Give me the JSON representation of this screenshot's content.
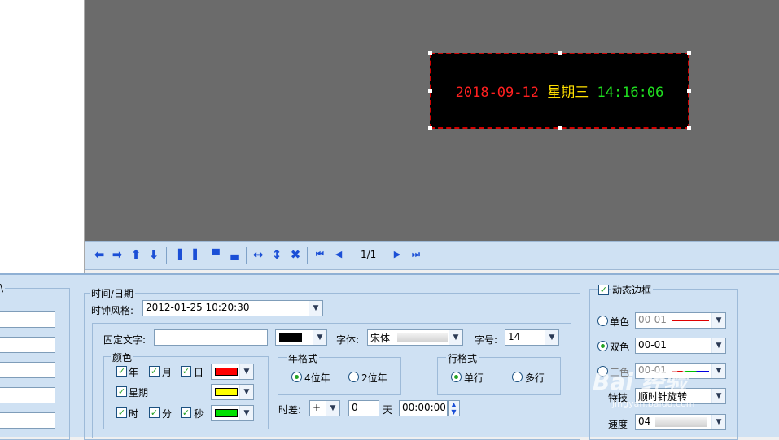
{
  "led": {
    "date": "2018-09-12",
    "weekday": "星期三",
    "time": "14:16:06",
    "date_color": "#ff2020",
    "weekday_color": "#ffe000",
    "time_color": "#20e020"
  },
  "toolbar": {
    "page_indicator": "1/1",
    "icons": [
      "arrow-left-icon",
      "arrow-right-icon",
      "arrow-up-icon",
      "arrow-down-icon",
      "align-left-icon",
      "align-right-icon",
      "align-top-icon",
      "align-bottom-icon",
      "equal-width-icon",
      "equal-height-icon",
      "fit-size-icon",
      "first-page-icon",
      "prev-page-icon",
      "next-page-icon",
      "last-page-icon"
    ]
  },
  "datetime": {
    "group_title": "时间/日期",
    "style_label": "时钟风格:",
    "style_value": "2012-01-25 10:20:30",
    "fixed_text_label": "固定文字:",
    "fixed_text_value": "",
    "font_label": "字体:",
    "font_value": "宋体",
    "size_label": "字号:",
    "size_value": "14",
    "color_group": "颜色",
    "year": "年",
    "month": "月",
    "day": "日",
    "week": "星期",
    "hour": "时",
    "minute": "分",
    "second": "秒",
    "year_format_group": "年格式",
    "four_digit": "4位年",
    "two_digit": "2位年",
    "line_format_group": "行格式",
    "single_line": "单行",
    "multi_line": "多行",
    "offset_label": "时差:",
    "offset_sign": "+",
    "offset_days": "0",
    "days_unit": "天",
    "offset_time": "00:00:00",
    "colors": {
      "date": "#ff0000",
      "week": "#ffff00",
      "time": "#00e000",
      "fixed": "#000000"
    }
  },
  "border": {
    "title": "动态边框",
    "single": "单色",
    "double": "双色",
    "triple": "三色",
    "single_value": "00-01",
    "double_value": "00-01",
    "triple_value": "00-01",
    "effect_label": "特技",
    "effect_value": "顺时针旋转",
    "speed_label": "速度",
    "speed_value": "04"
  },
  "watermark": {
    "text": "Bai 经验",
    "sub": "jingyan.baidu.com"
  }
}
